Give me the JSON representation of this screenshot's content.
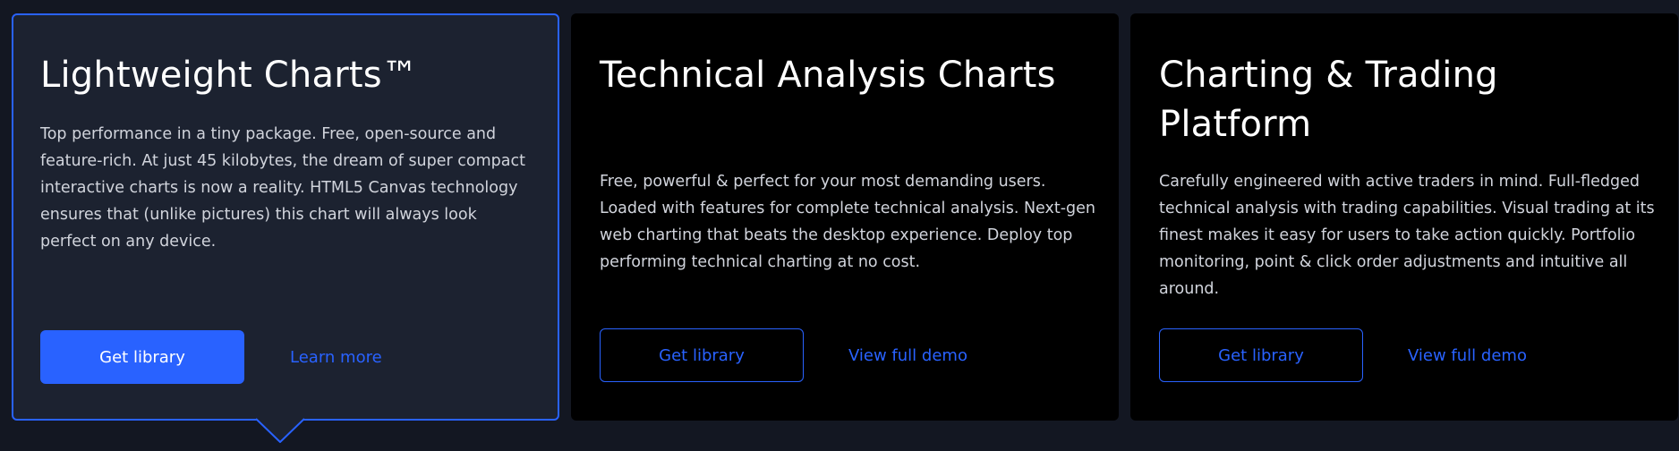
{
  "products": [
    {
      "title": "Lightweight Charts™",
      "description": "Top performance in a tiny package. Free, open-source and feature-rich. At just 45 kilobytes, the dream of super compact interactive charts is now a reality. HTML5 Canvas technology ensures that (unlike pictures) this chart will always look perfect on any device.",
      "primary_button": "Get library",
      "secondary_link": "Learn more",
      "selected": true
    },
    {
      "title": "Technical Analysis Charts",
      "description": "Free, powerful & perfect for your most demanding users. Loaded with features for complete technical analysis. Next-gen web charting that beats the desktop experience. Deploy top performing technical charting at no cost.",
      "primary_button": "Get library",
      "secondary_link": "View full demo",
      "selected": false
    },
    {
      "title": "Charting & Trading Platform",
      "description": "Carefully engineered with active traders in mind. Full-fledged technical analysis with trading capabilities. Visual trading at its finest makes it easy for users to take action quickly. Portfolio monitoring, point & click order adjustments and intuitive all around.",
      "primary_button": "Get library",
      "secondary_link": "View full demo",
      "selected": false
    }
  ],
  "colors": {
    "background": "#131722",
    "accent": "#2962ff",
    "selected_card": "#1c2230",
    "card": "#000000",
    "text": "#ffffff",
    "muted_text": "#d1d4dc"
  }
}
